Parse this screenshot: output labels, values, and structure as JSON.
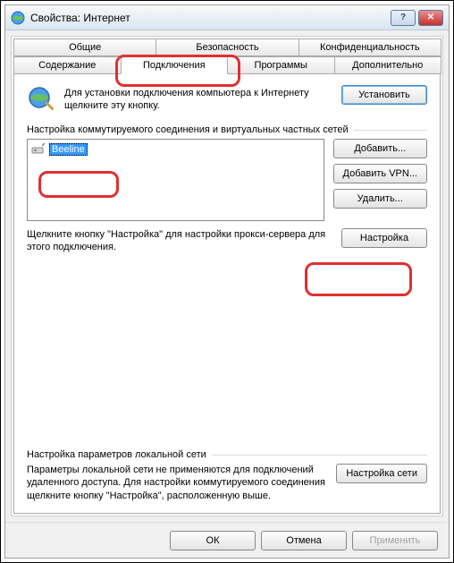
{
  "window": {
    "title": "Свойства: Интернет"
  },
  "tabs": {
    "row1": [
      "Общие",
      "Безопасность",
      "Конфиденциальность"
    ],
    "row2": [
      "Содержание",
      "Подключения",
      "Программы",
      "Дополнительно"
    ],
    "active": "Подключения"
  },
  "setup": {
    "text": "Для установки подключения компьютера к Интернету щелкните эту кнопку.",
    "button": "Установить"
  },
  "dial": {
    "section": "Настройка коммутируемого соединения и виртуальных частных сетей",
    "items": [
      {
        "name": "Beeline"
      }
    ],
    "add": "Добавить...",
    "addvpn": "Добавить VPN...",
    "remove": "Удалить...",
    "proxyText": "Щелкните кнопку \"Настройка\" для настройки прокси-сервера для этого подключения.",
    "settings": "Настройка"
  },
  "lan": {
    "section": "Настройка параметров локальной сети",
    "text": "Параметры локальной сети не применяются для подключений удаленного доступа. Для настройки коммутируемого соединения щелкните кнопку \"Настройка\", расположенную выше.",
    "button": "Настройка сети"
  },
  "footer": {
    "ok": "ОК",
    "cancel": "Отмена",
    "apply": "Применить"
  }
}
